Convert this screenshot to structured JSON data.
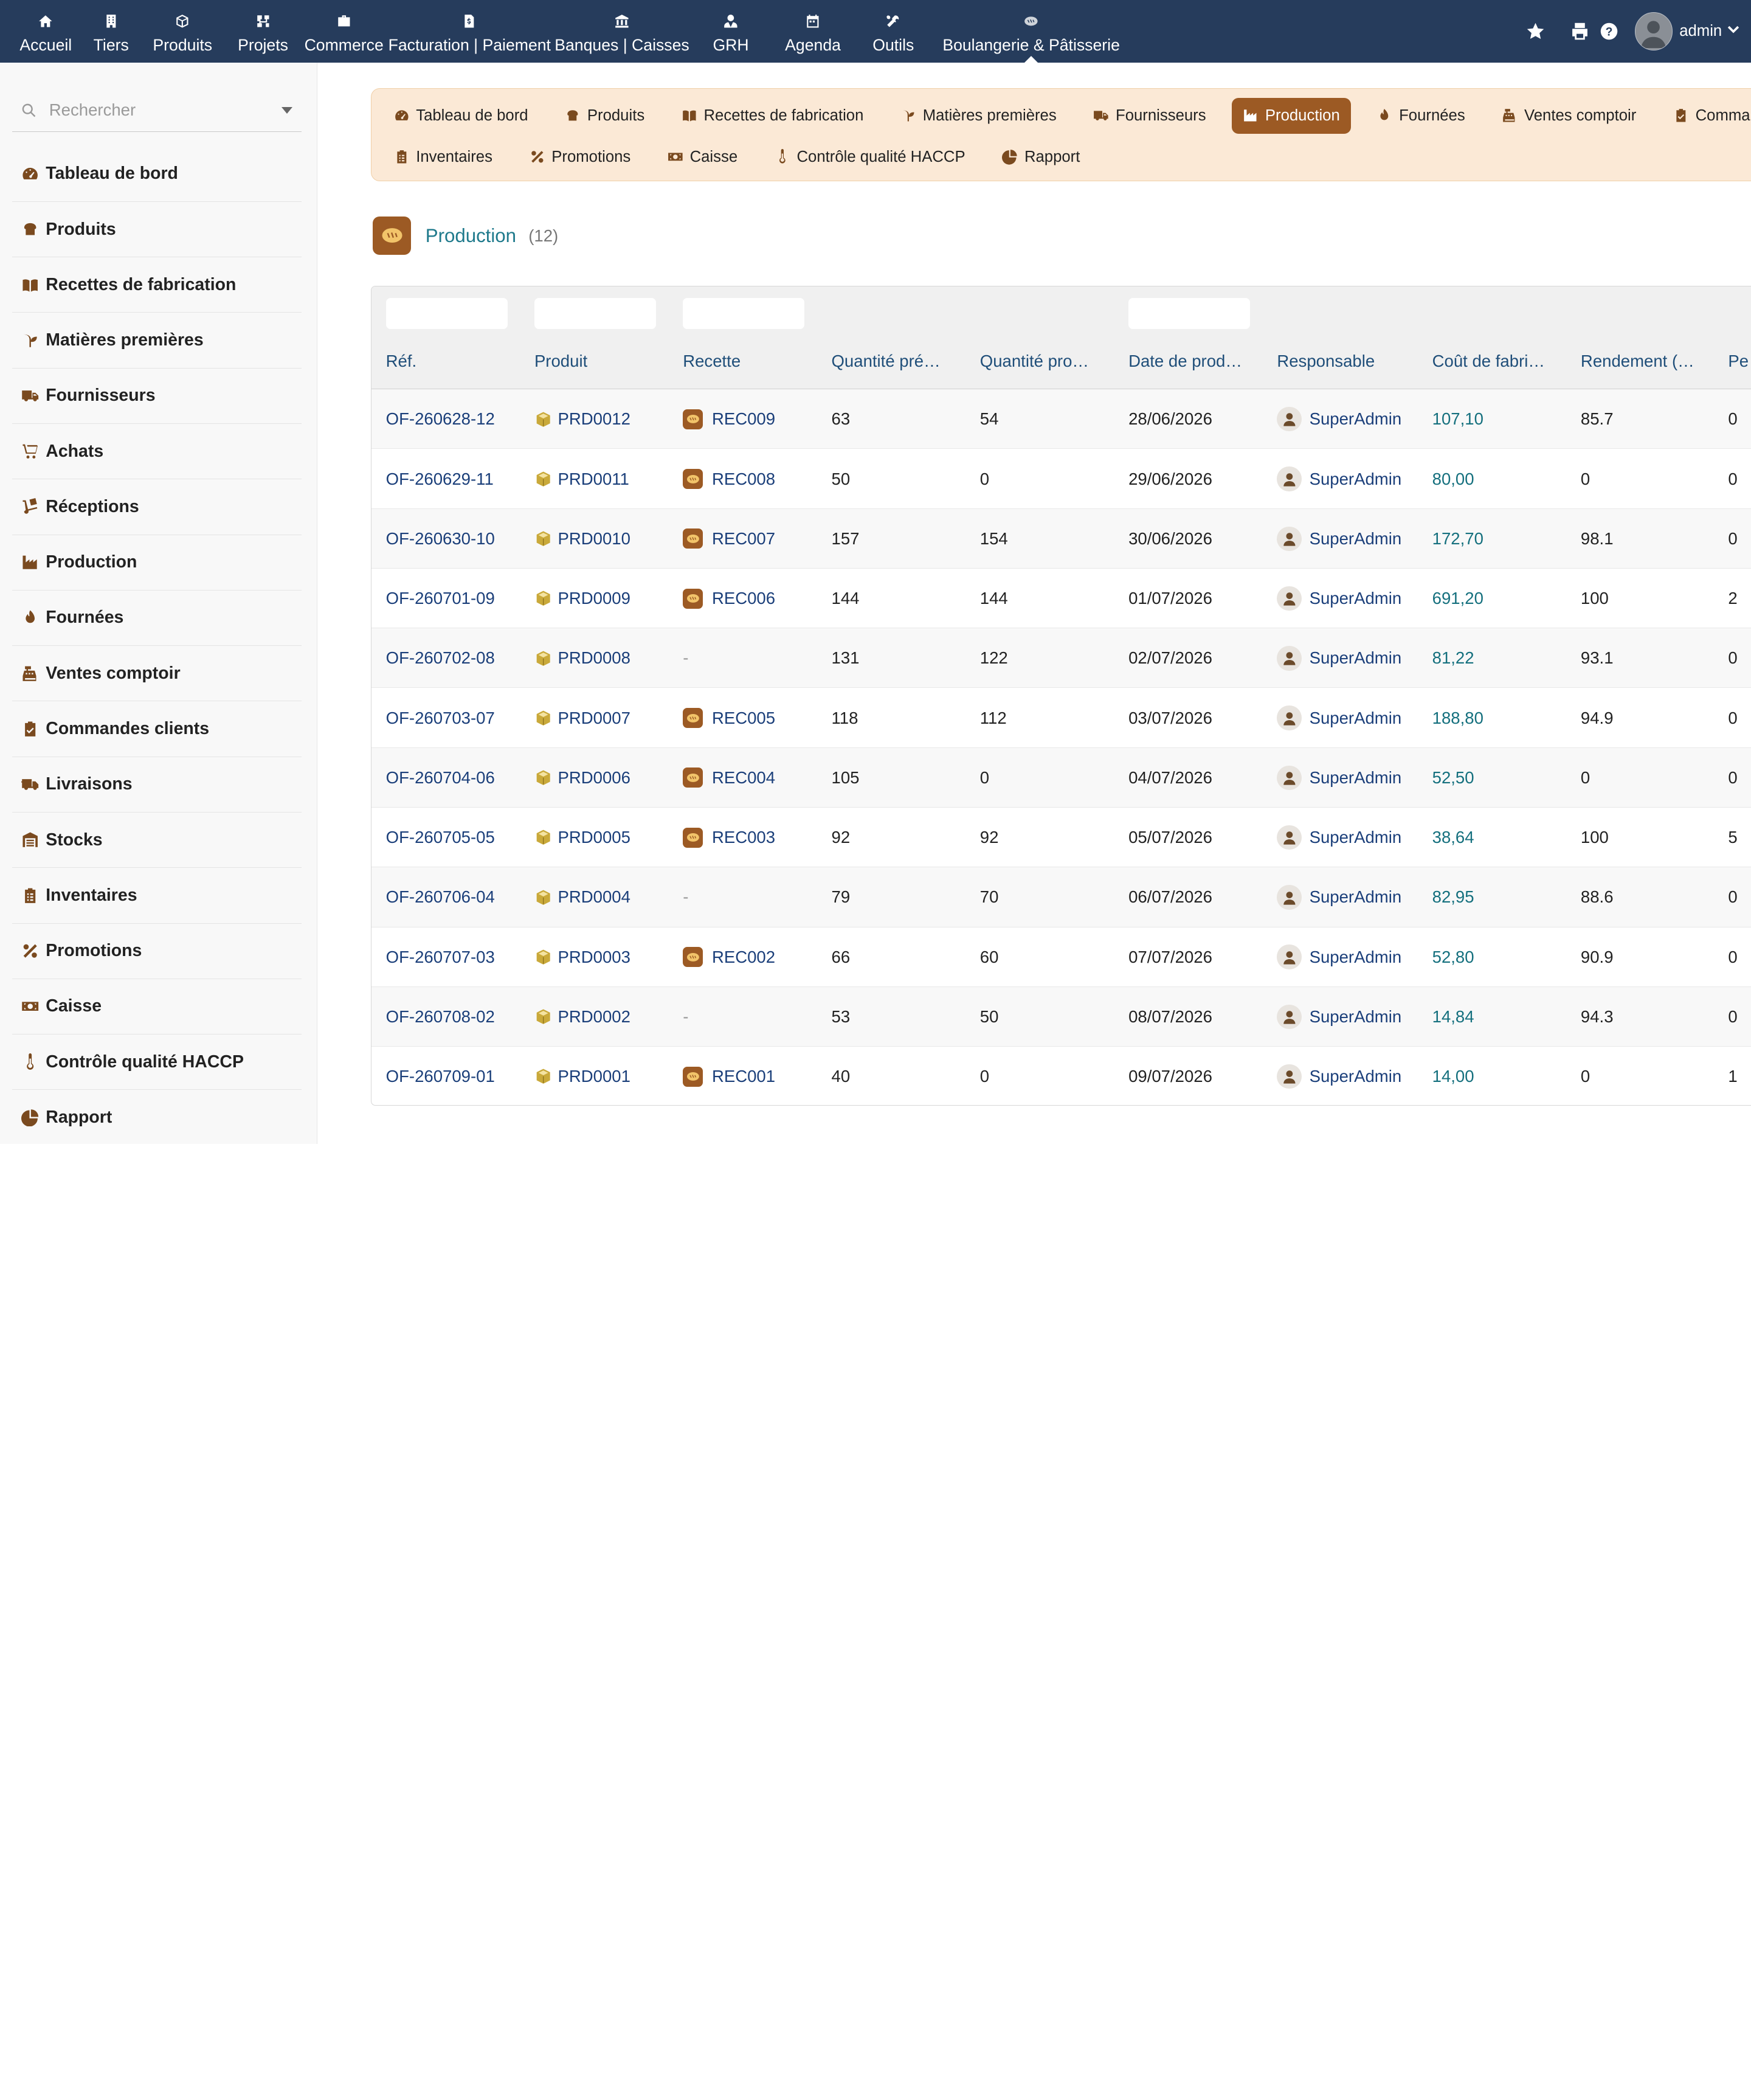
{
  "topnav": {
    "items": [
      {
        "label": "Accueil",
        "icon": "home-icon"
      },
      {
        "label": "Tiers",
        "icon": "building-icon"
      },
      {
        "label": "Produits",
        "icon": "cube-icon"
      },
      {
        "label": "Projets",
        "icon": "sitemap-icon"
      },
      {
        "label": "Commerce",
        "icon": "briefcase-icon"
      },
      {
        "label": "Facturation | Paiement",
        "icon": "invoice-icon"
      },
      {
        "label": "Banques | Caisses",
        "icon": "bank-icon"
      },
      {
        "label": "GRH",
        "icon": "user-tie-icon"
      },
      {
        "label": "Agenda",
        "icon": "calendar-icon"
      },
      {
        "label": "Outils",
        "icon": "tools-icon"
      },
      {
        "label": "Boulangerie & Pâtisserie",
        "icon": "bread-icon"
      }
    ],
    "user": "admin"
  },
  "search": {
    "placeholder": "Rechercher"
  },
  "sidebar": {
    "items": [
      {
        "label": "Tableau de bord",
        "icon": "dashboard-icon"
      },
      {
        "label": "Produits",
        "icon": "bread-loaf-icon"
      },
      {
        "label": "Recettes de fabrication",
        "icon": "book-open-icon"
      },
      {
        "label": "Matières premières",
        "icon": "seedling-icon"
      },
      {
        "label": "Fournisseurs",
        "icon": "truck-icon"
      },
      {
        "label": "Achats",
        "icon": "cart-icon"
      },
      {
        "label": "Réceptions",
        "icon": "dolly-icon"
      },
      {
        "label": "Production",
        "icon": "industry-icon"
      },
      {
        "label": "Fournées",
        "icon": "fire-icon"
      },
      {
        "label": "Ventes comptoir",
        "icon": "cash-register-icon"
      },
      {
        "label": "Commandes clients",
        "icon": "clipboard-check-icon"
      },
      {
        "label": "Livraisons",
        "icon": "delivery-truck-icon"
      },
      {
        "label": "Stocks",
        "icon": "warehouse-icon"
      },
      {
        "label": "Inventaires",
        "icon": "clipboard-list-icon"
      },
      {
        "label": "Promotions",
        "icon": "percent-icon"
      },
      {
        "label": "Caisse",
        "icon": "money-icon"
      },
      {
        "label": "Contrôle qualité HACCP",
        "icon": "thermometer-icon"
      },
      {
        "label": "Rapport",
        "icon": "chart-pie-icon"
      }
    ]
  },
  "tabs": {
    "row1": [
      {
        "label": "Tableau de bord",
        "icon": "dashboard-icon"
      },
      {
        "label": "Produits",
        "icon": "bread-loaf-icon"
      },
      {
        "label": "Recettes de fabrication",
        "icon": "book-open-icon"
      },
      {
        "label": "Matières premières",
        "icon": "seedling-icon"
      },
      {
        "label": "Fournisseurs",
        "icon": "truck-icon"
      },
      {
        "label": "Production",
        "icon": "industry-icon",
        "active": true
      },
      {
        "label": "Fournées",
        "icon": "fire-icon"
      },
      {
        "label": "Ventes comptoir",
        "icon": "cash-register-icon"
      },
      {
        "label": "Commandes",
        "icon": "clipboard-check-icon"
      }
    ],
    "row2": [
      {
        "label": "Inventaires",
        "icon": "clipboard-list-icon"
      },
      {
        "label": "Promotions",
        "icon": "percent-icon"
      },
      {
        "label": "Caisse",
        "icon": "money-icon"
      },
      {
        "label": "Contrôle qualité HACCP",
        "icon": "thermometer-icon"
      },
      {
        "label": "Rapport",
        "icon": "chart-pie-icon"
      }
    ]
  },
  "page": {
    "title": "Production",
    "count": "(12)"
  },
  "table": {
    "headers": [
      "Réf.",
      "Produit",
      "Recette",
      "Quantité pré…",
      "Quantité pro…",
      "Date de prod…",
      "Responsable",
      "Coût de fabri…",
      "Rendement (…",
      "Pe"
    ],
    "rows": [
      {
        "ref": "OF-260628-12",
        "product": "PRD0012",
        "recipe": "REC009",
        "qty_planned": "63",
        "qty_produced": "54",
        "date": "28/06/2026",
        "owner": "SuperAdmin",
        "cost": "107,10",
        "yield": "85.7",
        "pe": "0"
      },
      {
        "ref": "OF-260629-11",
        "product": "PRD0011",
        "recipe": "REC008",
        "qty_planned": "50",
        "qty_produced": "0",
        "date": "29/06/2026",
        "owner": "SuperAdmin",
        "cost": "80,00",
        "yield": "0",
        "pe": "0"
      },
      {
        "ref": "OF-260630-10",
        "product": "PRD0010",
        "recipe": "REC007",
        "qty_planned": "157",
        "qty_produced": "154",
        "date": "30/06/2026",
        "owner": "SuperAdmin",
        "cost": "172,70",
        "yield": "98.1",
        "pe": "0"
      },
      {
        "ref": "OF-260701-09",
        "product": "PRD0009",
        "recipe": "REC006",
        "qty_planned": "144",
        "qty_produced": "144",
        "date": "01/07/2026",
        "owner": "SuperAdmin",
        "cost": "691,20",
        "yield": "100",
        "pe": "2"
      },
      {
        "ref": "OF-260702-08",
        "product": "PRD0008",
        "recipe": "-",
        "qty_planned": "131",
        "qty_produced": "122",
        "date": "02/07/2026",
        "owner": "SuperAdmin",
        "cost": "81,22",
        "yield": "93.1",
        "pe": "0"
      },
      {
        "ref": "OF-260703-07",
        "product": "PRD0007",
        "recipe": "REC005",
        "qty_planned": "118",
        "qty_produced": "112",
        "date": "03/07/2026",
        "owner": "SuperAdmin",
        "cost": "188,80",
        "yield": "94.9",
        "pe": "0"
      },
      {
        "ref": "OF-260704-06",
        "product": "PRD0006",
        "recipe": "REC004",
        "qty_planned": "105",
        "qty_produced": "0",
        "date": "04/07/2026",
        "owner": "SuperAdmin",
        "cost": "52,50",
        "yield": "0",
        "pe": "0"
      },
      {
        "ref": "OF-260705-05",
        "product": "PRD0005",
        "recipe": "REC003",
        "qty_planned": "92",
        "qty_produced": "92",
        "date": "05/07/2026",
        "owner": "SuperAdmin",
        "cost": "38,64",
        "yield": "100",
        "pe": "5"
      },
      {
        "ref": "OF-260706-04",
        "product": "PRD0004",
        "recipe": "-",
        "qty_planned": "79",
        "qty_produced": "70",
        "date": "06/07/2026",
        "owner": "SuperAdmin",
        "cost": "82,95",
        "yield": "88.6",
        "pe": "0"
      },
      {
        "ref": "OF-260707-03",
        "product": "PRD0003",
        "recipe": "REC002",
        "qty_planned": "66",
        "qty_produced": "60",
        "date": "07/07/2026",
        "owner": "SuperAdmin",
        "cost": "52,80",
        "yield": "90.9",
        "pe": "0"
      },
      {
        "ref": "OF-260708-02",
        "product": "PRD0002",
        "recipe": "-",
        "qty_planned": "53",
        "qty_produced": "50",
        "date": "08/07/2026",
        "owner": "SuperAdmin",
        "cost": "14,84",
        "yield": "94.3",
        "pe": "0"
      },
      {
        "ref": "OF-260709-01",
        "product": "PRD0001",
        "recipe": "REC001",
        "qty_planned": "40",
        "qty_produced": "0",
        "date": "09/07/2026",
        "owner": "SuperAdmin",
        "cost": "14,00",
        "yield": "0",
        "pe": "1"
      }
    ]
  },
  "colors": {
    "topbar": "#263c5c",
    "accent": "#9c5a24",
    "tabs_bg": "#fbe9d6",
    "link": "#1b3f7a",
    "cost": "#15707e"
  }
}
